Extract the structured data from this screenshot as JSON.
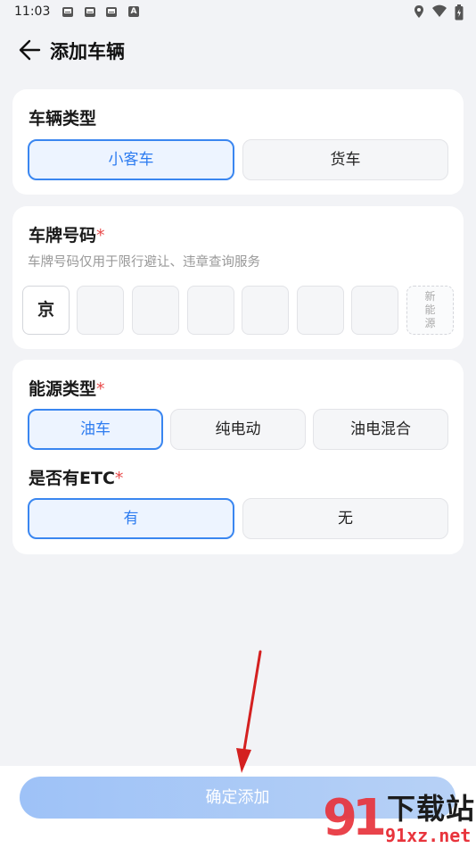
{
  "status_bar": {
    "time": "11:03",
    "notification_icons": [
      "mail-icon",
      "mail-icon",
      "mail-icon",
      "a-icon"
    ],
    "notification_a": "A",
    "system_icons": [
      "location-icon",
      "wifi-icon",
      "battery-icon"
    ]
  },
  "header": {
    "title": "添加车辆",
    "back_icon": "arrow-left-icon"
  },
  "vehicle_type": {
    "title": "车辆类型",
    "options": [
      "小客车",
      "货车"
    ],
    "selected": "小客车"
  },
  "plate": {
    "title": "车牌号码",
    "required_mark": "*",
    "hint": "车牌号码仅用于限行避让、违章查询服务",
    "province": "京",
    "new_energy": [
      "新",
      "能",
      "源"
    ]
  },
  "energy_type": {
    "title": "能源类型",
    "required_mark": "*",
    "options": [
      "油车",
      "纯电动",
      "油电混合"
    ],
    "selected": "油车"
  },
  "etc": {
    "title": "是否有ETC",
    "required_mark": "*",
    "options": [
      "有",
      "无"
    ],
    "selected": "有"
  },
  "footer": {
    "confirm_label": "确定添加"
  },
  "watermark": {
    "logo_number": "91",
    "title": "下载站",
    "domain": "91xz.net"
  },
  "colors": {
    "accent": "#2d7cf0",
    "selected_bg": "#edf4ff",
    "required": "#e84a4a",
    "annotation_arrow": "#d42020",
    "watermark_red": "#e8343c"
  }
}
